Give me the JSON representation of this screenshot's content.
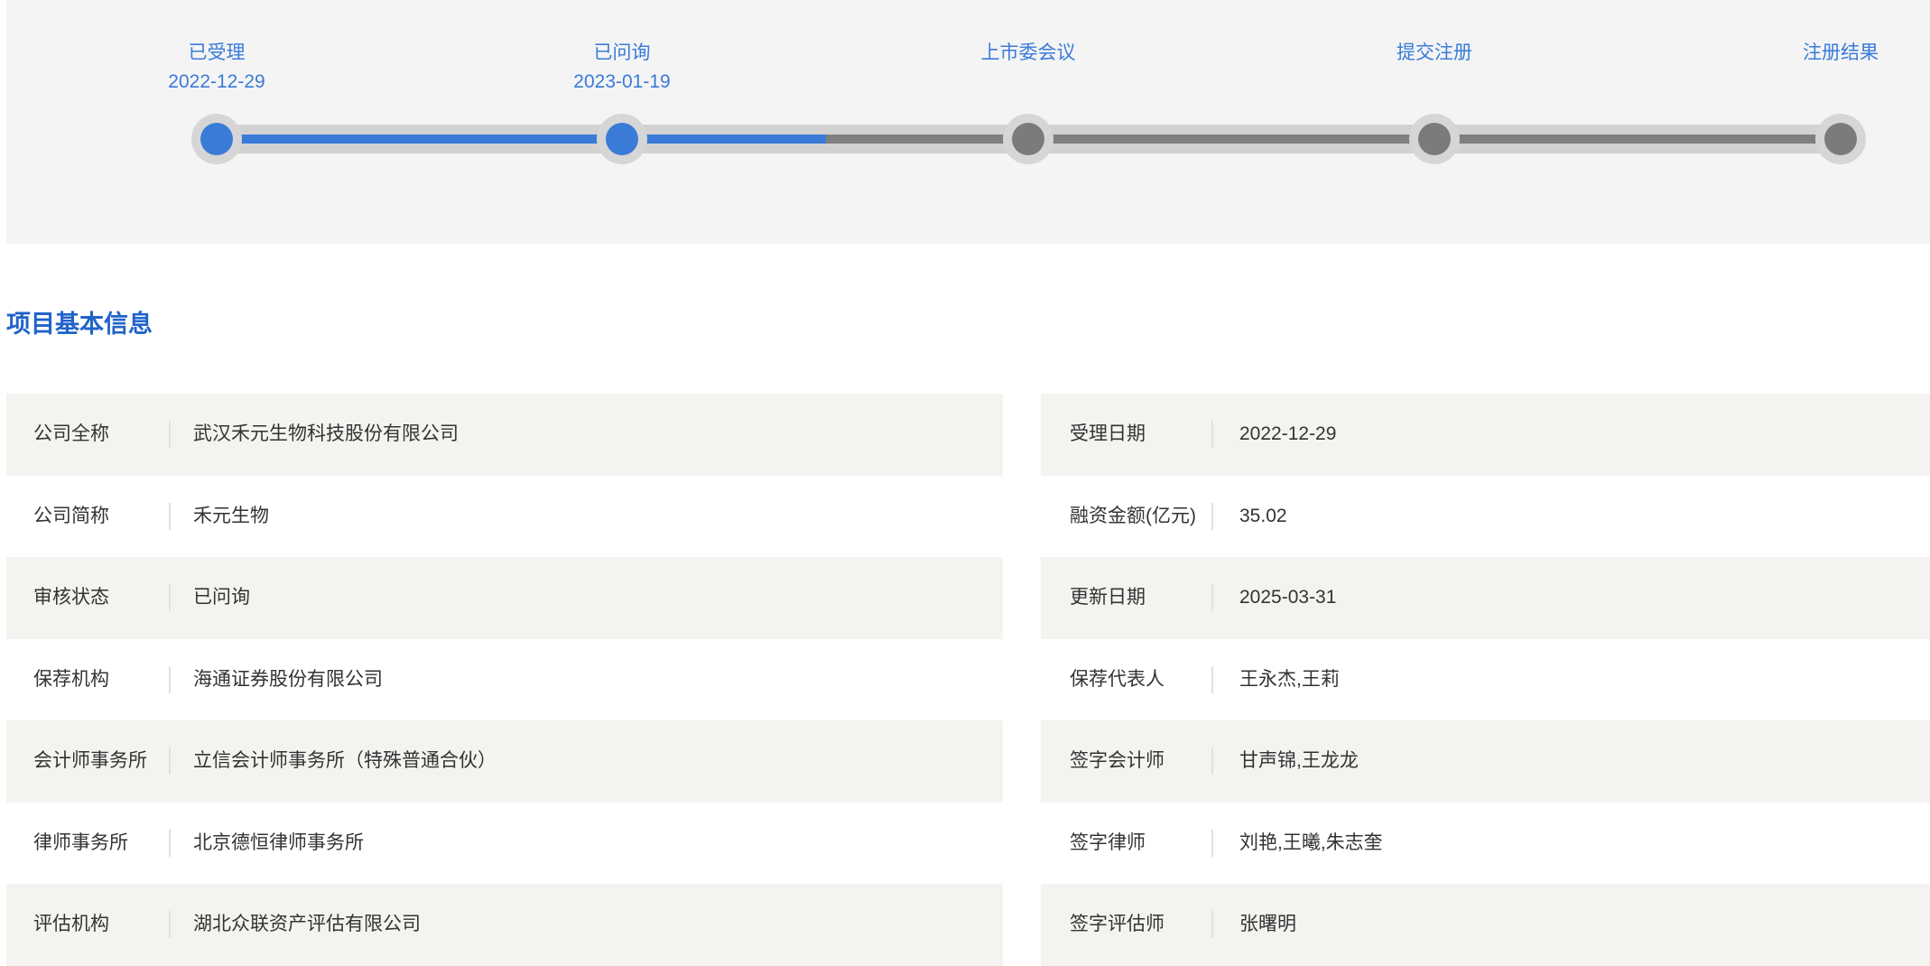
{
  "timeline": {
    "steps": [
      {
        "label": "已受理",
        "date": "2022-12-29",
        "state": "done"
      },
      {
        "label": "已问询",
        "date": "2023-01-19",
        "state": "done"
      },
      {
        "label": "上市委会议",
        "date": "",
        "state": "pending"
      },
      {
        "label": "提交注册",
        "date": "",
        "state": "pending"
      },
      {
        "label": "注册结果",
        "date": "",
        "state": "pending"
      }
    ]
  },
  "section": {
    "title": "项目基本信息"
  },
  "info_table": {
    "left": [
      {
        "label": "公司全称",
        "value": "武汉禾元生物科技股份有限公司"
      },
      {
        "label": "公司简称",
        "value": "禾元生物"
      },
      {
        "label": "审核状态",
        "value": "已问询"
      },
      {
        "label": "保荐机构",
        "value": "海通证券股份有限公司"
      },
      {
        "label": "会计师事务所",
        "value": "立信会计师事务所（特殊普通合伙）"
      },
      {
        "label": "律师事务所",
        "value": "北京德恒律师事务所"
      },
      {
        "label": "评估机构",
        "value": "湖北众联资产评估有限公司"
      }
    ],
    "right": [
      {
        "label": "受理日期",
        "value": "2022-12-29"
      },
      {
        "label": "融资金额(亿元)",
        "value": "35.02"
      },
      {
        "label": "更新日期",
        "value": "2025-03-31"
      },
      {
        "label": "保荐代表人",
        "value": "王永杰,王莉"
      },
      {
        "label": "签字会计师",
        "value": "甘声锦,王龙龙"
      },
      {
        "label": "签字律师",
        "value": "刘艳,王曦,朱志奎"
      },
      {
        "label": "签字评估师",
        "value": "张曙明"
      }
    ]
  },
  "colors": {
    "accent_blue": "#3a7bd8",
    "title_blue": "#2163c9",
    "pending_gray": "#7b7b7b",
    "track_gray": "#d2d2d2",
    "banner_bg": "#f4f4f5",
    "row_bg": "#f4f3f0",
    "text": "#333333"
  }
}
